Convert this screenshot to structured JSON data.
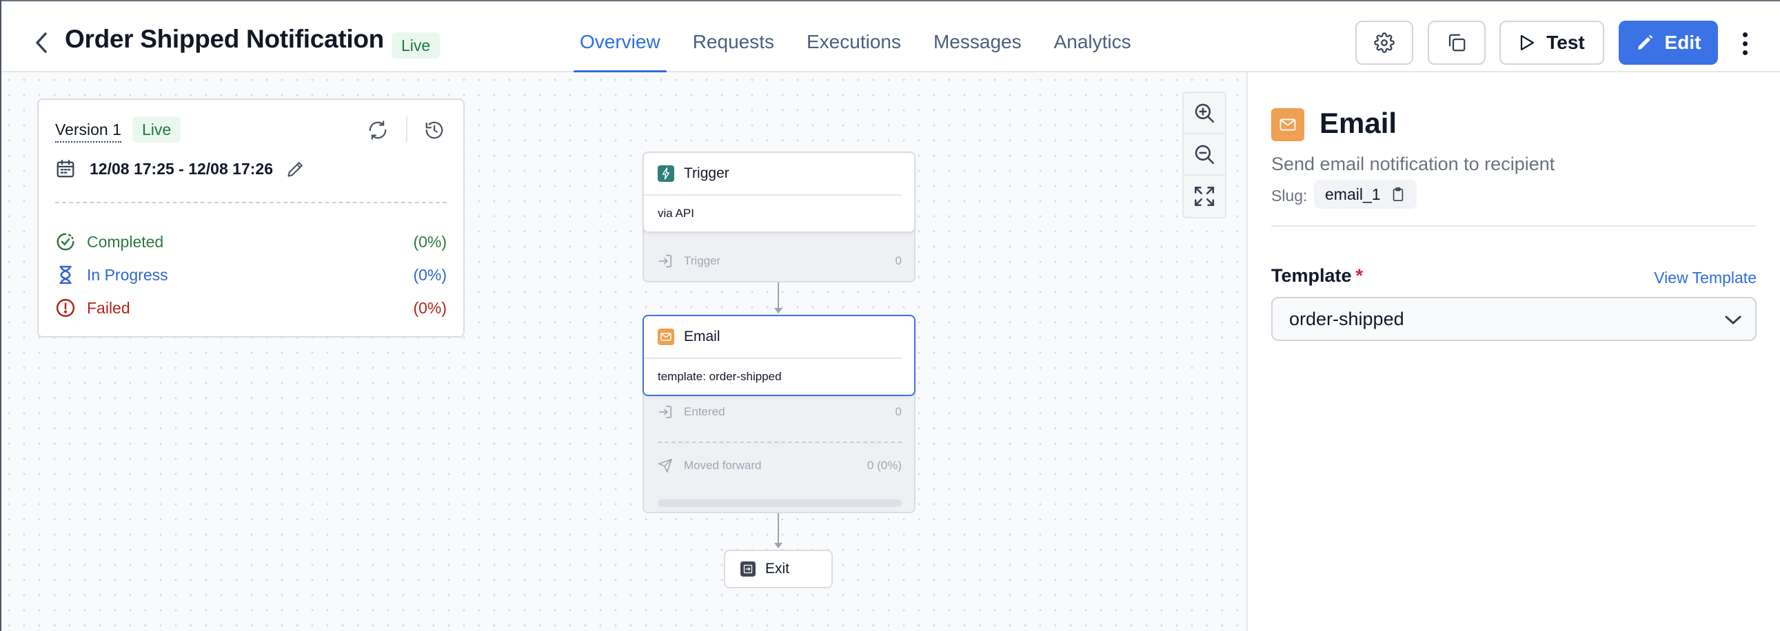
{
  "header": {
    "title": "Order Shipped Notification",
    "status_badge": "Live",
    "tabs": [
      {
        "label": "Overview",
        "active": true
      },
      {
        "label": "Requests",
        "active": false
      },
      {
        "label": "Executions",
        "active": false
      },
      {
        "label": "Messages",
        "active": false
      },
      {
        "label": "Analytics",
        "active": false
      }
    ],
    "test_label": "Test",
    "edit_label": "Edit"
  },
  "version_card": {
    "version_label": "Version 1",
    "status_badge": "Live",
    "date_range": "12/08 17:25 - 12/08 17:26",
    "stats": [
      {
        "label": "Completed",
        "value": "(0%)",
        "color": "#2b7a3d"
      },
      {
        "label": "In Progress",
        "value": "(0%)",
        "color": "#2f66cf"
      },
      {
        "label": "Failed",
        "value": "(0%)",
        "color": "#b42318"
      }
    ]
  },
  "flow": {
    "trigger": {
      "title": "Trigger",
      "subtitle": "via API",
      "stat_label": "Trigger",
      "stat_value": "0"
    },
    "email": {
      "title": "Email",
      "subtitle": "template: order-shipped",
      "entered_label": "Entered",
      "entered_value": "0",
      "moved_label": "Moved forward",
      "moved_value": "0 (0%)",
      "progress_fraction": 0
    },
    "exit": {
      "title": "Exit"
    }
  },
  "panel": {
    "title": "Email",
    "description": "Send email notification to recipient",
    "slug_label": "Slug:",
    "slug_value": "email_1",
    "template_label": "Template",
    "required_mark": "*",
    "view_template_label": "View Template",
    "template_value": "order-shipped"
  },
  "colors": {
    "accent": "#3b73e6",
    "live_bg": "#eaf7ee",
    "live_text": "#1d7a3e",
    "email_icon": "#f0a052",
    "trigger_icon": "#2f7f78"
  }
}
